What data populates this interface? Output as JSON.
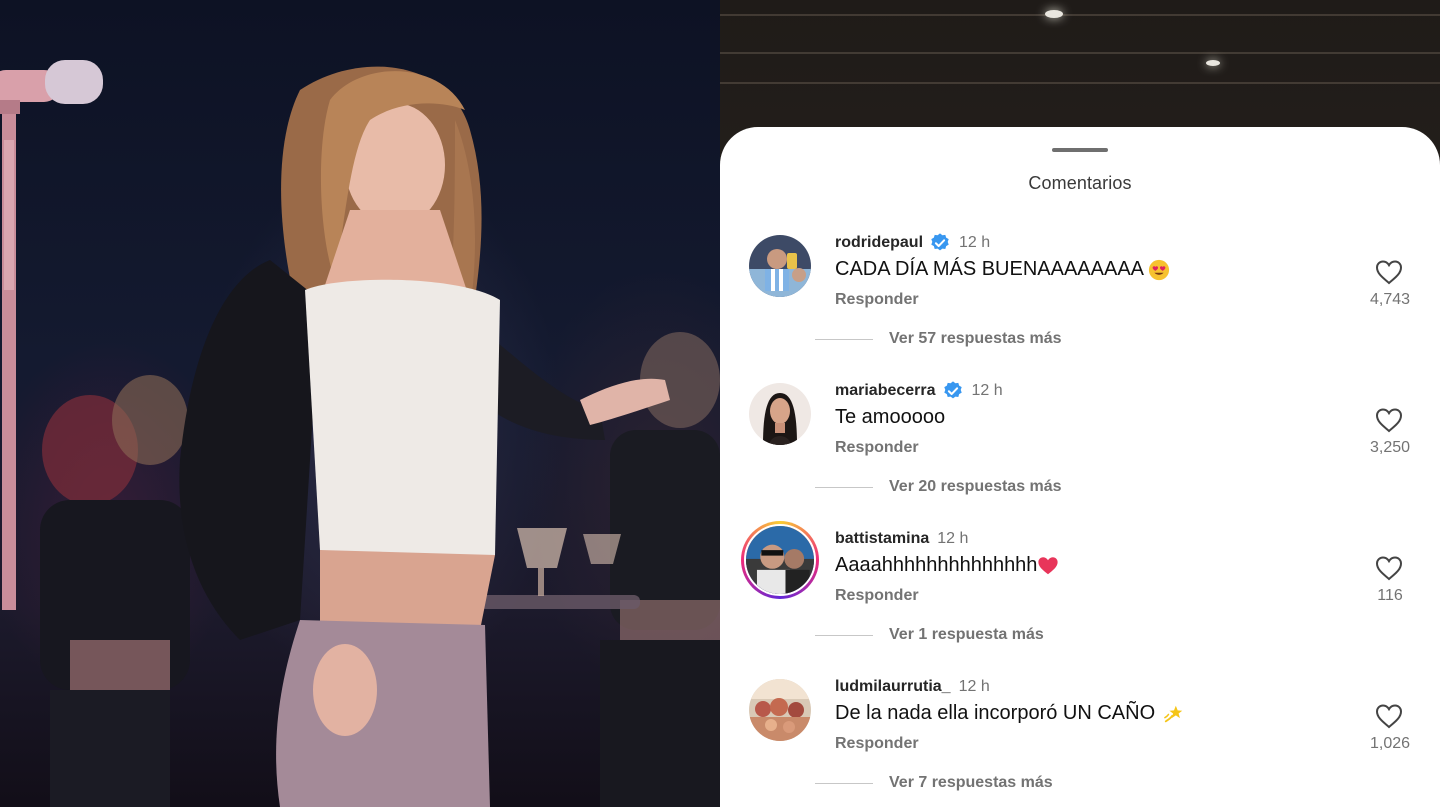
{
  "sheet": {
    "title": "Comentarios"
  },
  "colors": {
    "verified": "#3897f0",
    "heart_red": "#e0245e",
    "muted_text": "#737373"
  },
  "comments": [
    {
      "username": "rodridepaul",
      "verified": true,
      "time": "12 h",
      "text": "CADA DÍA MÁS BUENAAAAAAAA",
      "emoji": "heart-eyes-emoji",
      "reply_label": "Responder",
      "likes": "4,743",
      "more_replies": "Ver 57 respuestas más"
    },
    {
      "username": "mariabecerra",
      "verified": true,
      "time": "12 h",
      "text": "Te amooooo",
      "emoji": "",
      "reply_label": "Responder",
      "likes": "3,250",
      "more_replies": "Ver 20 respuestas más"
    },
    {
      "username": "battistamina",
      "verified": false,
      "time": "12 h",
      "text": "Aaaahhhhhhhhhhhhhh",
      "emoji": "red-heart-emoji",
      "reply_label": "Responder",
      "likes": "116",
      "more_replies": "Ver 1 respuesta más"
    },
    {
      "username": "ludmilaurrutia_",
      "verified": false,
      "time": "12 h",
      "text": "De la nada ella incorporó UN CAÑO",
      "emoji": "dizzy-emoji",
      "reply_label": "Responder",
      "likes": "1,026",
      "more_replies": "Ver 7 respuestas más"
    }
  ]
}
